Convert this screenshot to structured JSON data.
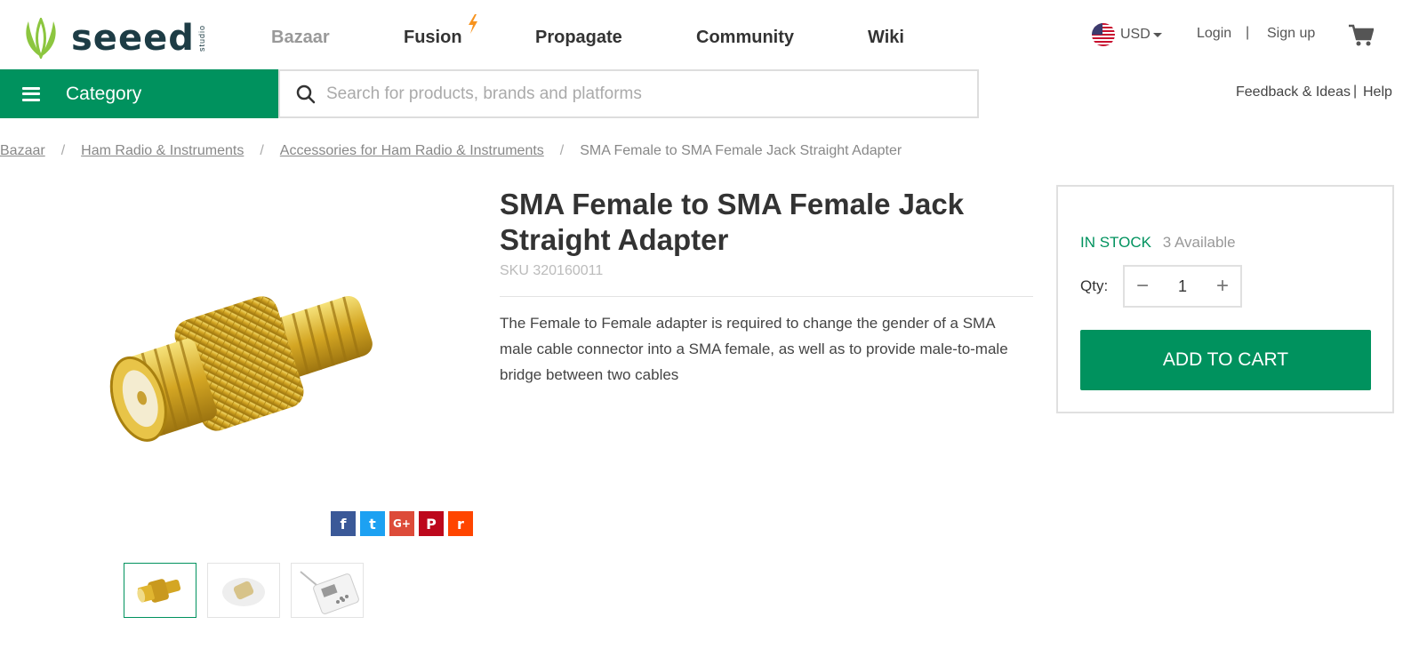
{
  "header": {
    "logo_text": "seeed",
    "logo_sub": "studio",
    "nav": [
      "Bazaar",
      "Fusion",
      "Propagate",
      "Community",
      "Wiki"
    ],
    "currency": "USD",
    "login": "Login",
    "separator": "|",
    "signup": "Sign up"
  },
  "bar": {
    "category_label": "Category",
    "search_placeholder": "Search for products, brands and platforms",
    "feedback": "Feedback & Ideas",
    "separator": "|",
    "help": "Help"
  },
  "breadcrumb": {
    "items": [
      "Bazaar",
      "Ham Radio & Instruments",
      "Accessories for Ham Radio & Instruments"
    ],
    "current": "SMA Female to SMA Female Jack Straight Adapter",
    "separator": "/"
  },
  "product": {
    "title": "SMA Female to SMA Female Jack Straight Adapter",
    "sku": "SKU 320160011",
    "description": "The Female to Female adapter is required to change the gender of a SMA male cable connector into a SMA female, as well as to provide male-to-male bridge between two cables"
  },
  "social": [
    "f",
    "t",
    "G+",
    "P",
    "r"
  ],
  "buybox": {
    "stock_status": "IN STOCK",
    "available": "3 Available",
    "qty_label": "Qty",
    "qty_colon": ":",
    "qty_value": "1",
    "minus": "−",
    "plus": "+",
    "add_to_cart": "ADD TO CART"
  },
  "colors": {
    "brand_green": "#00925e",
    "logo_navy": "#1d3c45",
    "logo_leaf": "#8cc63f",
    "fusion_bolt": "#f7931e"
  }
}
